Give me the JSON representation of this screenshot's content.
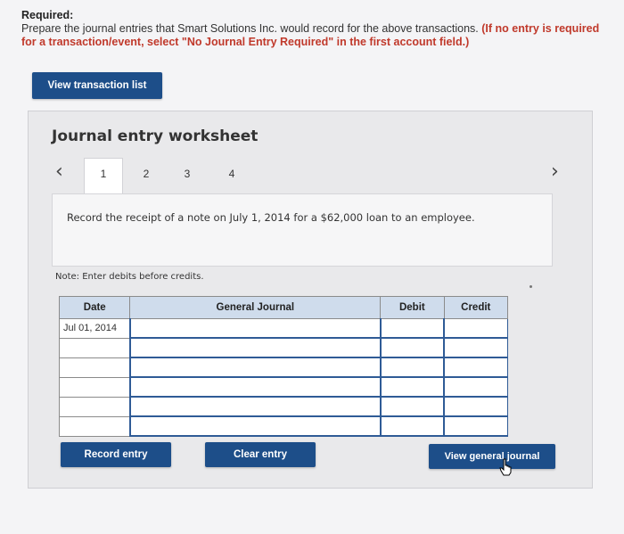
{
  "required": {
    "title": "Required:",
    "instruction": "Prepare the journal entries that Smart Solutions Inc. would record for the above transactions.",
    "note_part1": "(If no entry is",
    "note_part2": "required for a transaction/event, select \"No Journal Entry Required\" in the first account field.)"
  },
  "buttons": {
    "view_transaction_list": "View transaction list",
    "record_entry": "Record entry",
    "clear_entry": "Clear entry",
    "view_general_journal": "View general journal"
  },
  "worksheet": {
    "title": "Journal entry worksheet",
    "tabs": [
      "1",
      "2",
      "3",
      "4"
    ],
    "active_tab": "1",
    "description": "Record the receipt of a note on July 1, 2014 for a $62,000 loan to an employee.",
    "note": "Note: Enter debits before credits."
  },
  "table": {
    "headers": {
      "date": "Date",
      "general_journal": "General Journal",
      "debit": "Debit",
      "credit": "Credit"
    },
    "first_date": "Jul 01, 2014"
  },
  "icons": {
    "prev": "chevron-left-icon",
    "next": "chevron-right-icon",
    "cursor": "hand-cursor-icon"
  },
  "colors": {
    "button": "#1d4e89",
    "required_note": "#c0392b",
    "table_header": "#cfdcec"
  }
}
